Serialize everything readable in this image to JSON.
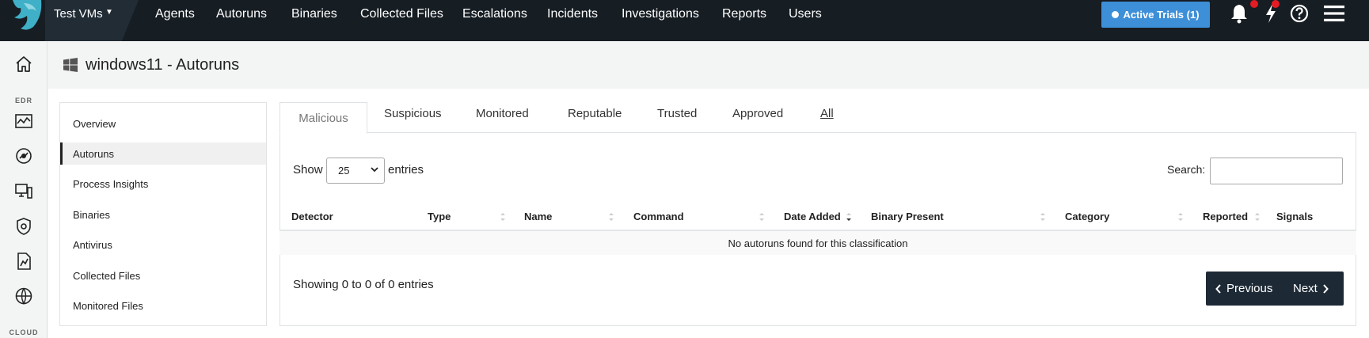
{
  "header": {
    "org": "Test VMs",
    "nav": [
      "Agents",
      "Autoruns",
      "Binaries",
      "Collected Files",
      "Escalations",
      "Incidents",
      "Investigations",
      "Reports",
      "Users"
    ],
    "trial_button": "Active Trials (1)"
  },
  "rail": {
    "edr_label": "EDR",
    "cloud_label": "CLOUD"
  },
  "page": {
    "title": "windows11 - Autoruns"
  },
  "subnav": {
    "items": [
      "Overview",
      "Autoruns",
      "Process Insights",
      "Binaries",
      "Antivirus",
      "Collected Files",
      "Monitored Files"
    ],
    "active": "Autoruns"
  },
  "tabs": [
    "Malicious",
    "Suspicious",
    "Monitored",
    "Reputable",
    "Trusted",
    "Approved",
    "All"
  ],
  "table": {
    "show_label": "Show",
    "page_size": "25",
    "entries_label": "entries",
    "search_label": "Search:",
    "columns": [
      "Detector",
      "Type",
      "Name",
      "Command",
      "Date Added",
      "Binary Present",
      "Category",
      "Reported",
      "Signals"
    ],
    "empty_message": "No autoruns found for this classification",
    "info": "Showing 0 to 0 of 0 entries",
    "previous_label": "Previous",
    "next_label": "Next"
  },
  "colors": {
    "topbar": "#161d23",
    "trial_button": "#3d8fd8",
    "notification_dot": "#e31b23",
    "pager": "#1d2a36"
  }
}
